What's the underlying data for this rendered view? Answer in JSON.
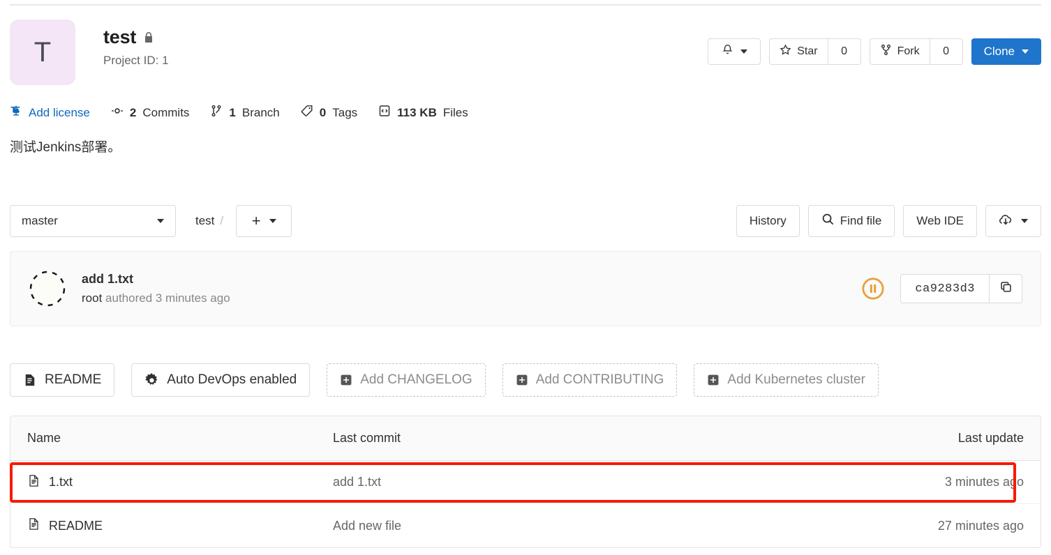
{
  "project": {
    "avatar_letter": "T",
    "avatar_bg": "#f4e6f6",
    "name": "test",
    "visibility_icon": "lock-icon",
    "project_id_label": "Project ID: 1",
    "description": "测试Jenkins部署。"
  },
  "header_actions": {
    "notification_icon": "bell-icon",
    "star_label": "Star",
    "star_count": "0",
    "star_icon": "star-icon",
    "fork_label": "Fork",
    "fork_count": "0",
    "fork_icon": "fork-icon",
    "clone_label": "Clone",
    "clone_bg": "#1f75cb"
  },
  "stats": [
    {
      "icon": "scale-icon",
      "value": "",
      "label": "Add license",
      "is_link": true
    },
    {
      "icon": "commit-icon",
      "value": "2",
      "label": "Commits",
      "is_link": false
    },
    {
      "icon": "branch-icon",
      "value": "1",
      "label": "Branch",
      "is_link": false
    },
    {
      "icon": "tag-icon",
      "value": "0",
      "label": "Tags",
      "is_link": false
    },
    {
      "icon": "files-icon",
      "value": "113 KB",
      "label": "Files",
      "is_link": false
    }
  ],
  "repo_controls": {
    "branch_name": "master",
    "breadcrumb_root": "test",
    "breadcrumb_separator": "/",
    "add_button_icon": "plus-icon",
    "history_label": "History",
    "find_file_label": "Find file",
    "find_file_icon": "search-icon",
    "web_ide_label": "Web IDE",
    "download_icon": "download-cloud-icon"
  },
  "commit": {
    "title": "add 1.txt",
    "author": "root",
    "meta_suffix": "authored 3 minutes ago",
    "pipeline_status_icon": "pipeline-paused-icon",
    "pipeline_status_color": "#e9a13b",
    "sha": "ca9283d3",
    "copy_icon": "copy-icon"
  },
  "quick_actions": [
    {
      "label": "README",
      "icon": "file-doc-icon",
      "style": "solid"
    },
    {
      "label": "Auto DevOps enabled",
      "icon": "gear-icon",
      "style": "solid"
    },
    {
      "label": "Add CHANGELOG",
      "icon": "plus-square-icon",
      "style": "dashed"
    },
    {
      "label": "Add CONTRIBUTING",
      "icon": "plus-square-icon",
      "style": "dashed"
    },
    {
      "label": "Add Kubernetes cluster",
      "icon": "plus-square-icon",
      "style": "dashed"
    }
  ],
  "files_table": {
    "columns": {
      "name": "Name",
      "last_commit": "Last commit",
      "last_update": "Last update"
    },
    "rows": [
      {
        "name": "1.txt",
        "icon": "file-icon",
        "last_commit": "add 1.txt",
        "last_update": "3 minutes ago",
        "highlighted": true
      },
      {
        "name": "README",
        "icon": "file-icon",
        "last_commit": "Add new file",
        "last_update": "27 minutes ago",
        "highlighted": false
      }
    ]
  },
  "annotation": {
    "highlight_color": "#f51b06"
  }
}
